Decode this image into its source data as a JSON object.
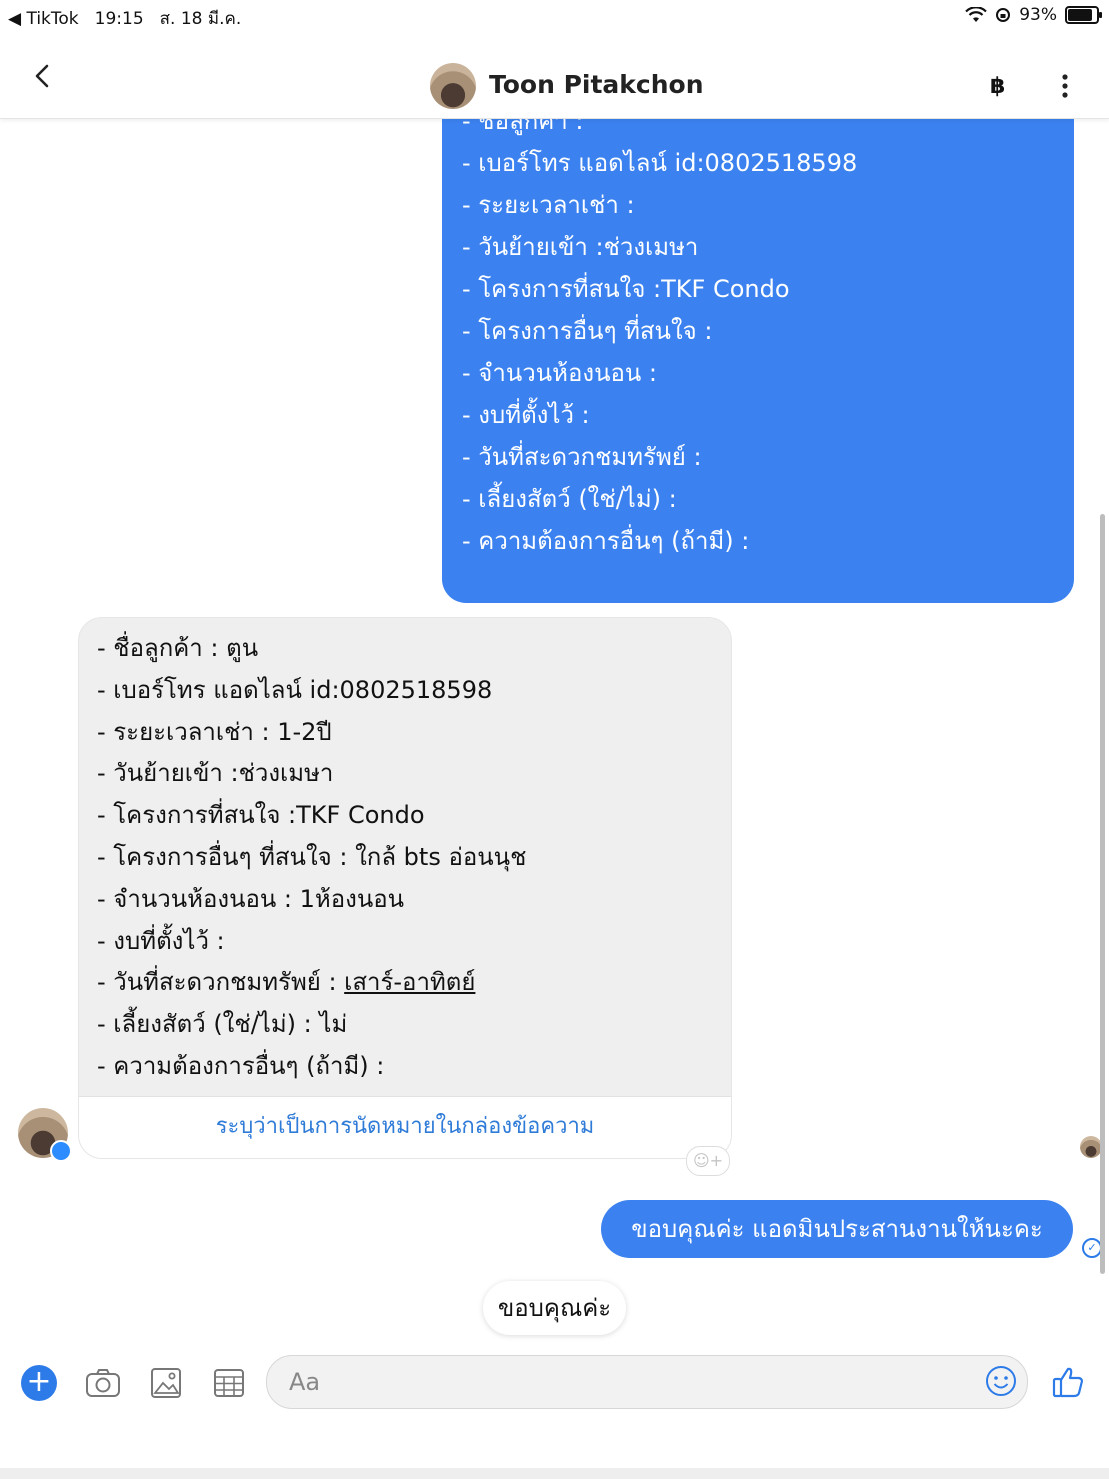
{
  "status_bar": {
    "back_app": "◀ TikTok",
    "time": "19:15",
    "date": "ส. 18 มี.ค.",
    "battery": "93%",
    "battery_level": 0.93
  },
  "header": {
    "contact_name": "Toon Pitakchon",
    "currency_icon": "฿"
  },
  "outgoing_form": {
    "lines": [
      "- ชื่อลูกค้า :",
      "- เบอร์โทร แอดไลน์ id:0802518598",
      "- ระยะเวลาเช่า :",
      "- วันย้ายเข้า :ช่วงเมษา",
      "- โครงการที่สนใจ :TKF Condo",
      "- โครงการอื่นๆ ที่สนใจ :",
      "- จำนวนห้องนอน :",
      "- งบที่ตั้งไว้ :",
      "- วันที่สะดวกชมทรัพย์ :",
      "- เลี้ยงสัตว์ (ใช่/ไม่) :",
      "- ความต้องการอื่นๆ (ถ้ามี) :"
    ]
  },
  "incoming_form": {
    "lines": [
      "- ชื่อลูกค้า : ตูน",
      "- เบอร์โทร แอดไลน์ id:0802518598",
      "- ระยะเวลาเช่า : 1-2ปี",
      "- วันย้ายเข้า :ช่วงเมษา",
      "- โครงการที่สนใจ :TKF Condo",
      "- โครงการอื่นๆ ที่สนใจ : ใกล้ bts อ่อนนุช",
      "- จำนวนห้องนอน : 1ห้องนอน",
      "- งบที่ตั้งไว้ :"
    ],
    "viewing_label": "- วันที่สะดวกชมทรัพย์ : ",
    "viewing_value": "เสาร์-อาทิตย์",
    "lines_after": [
      "- เลี้ยงสัตว์ (ใช่/ไม่) : ไม่",
      "- ความต้องการอื่นๆ (ถ้ามี) :"
    ],
    "action_label": "ระบุว่าเป็นการนัดหมายในกล่องข้อความ"
  },
  "outgoing_reply": "ขอบคุณค่ะ แอดมินประสานงานให้นะคะ",
  "quick_reply": "ขอบคุณค่ะ",
  "composer": {
    "placeholder": "Aa"
  }
}
